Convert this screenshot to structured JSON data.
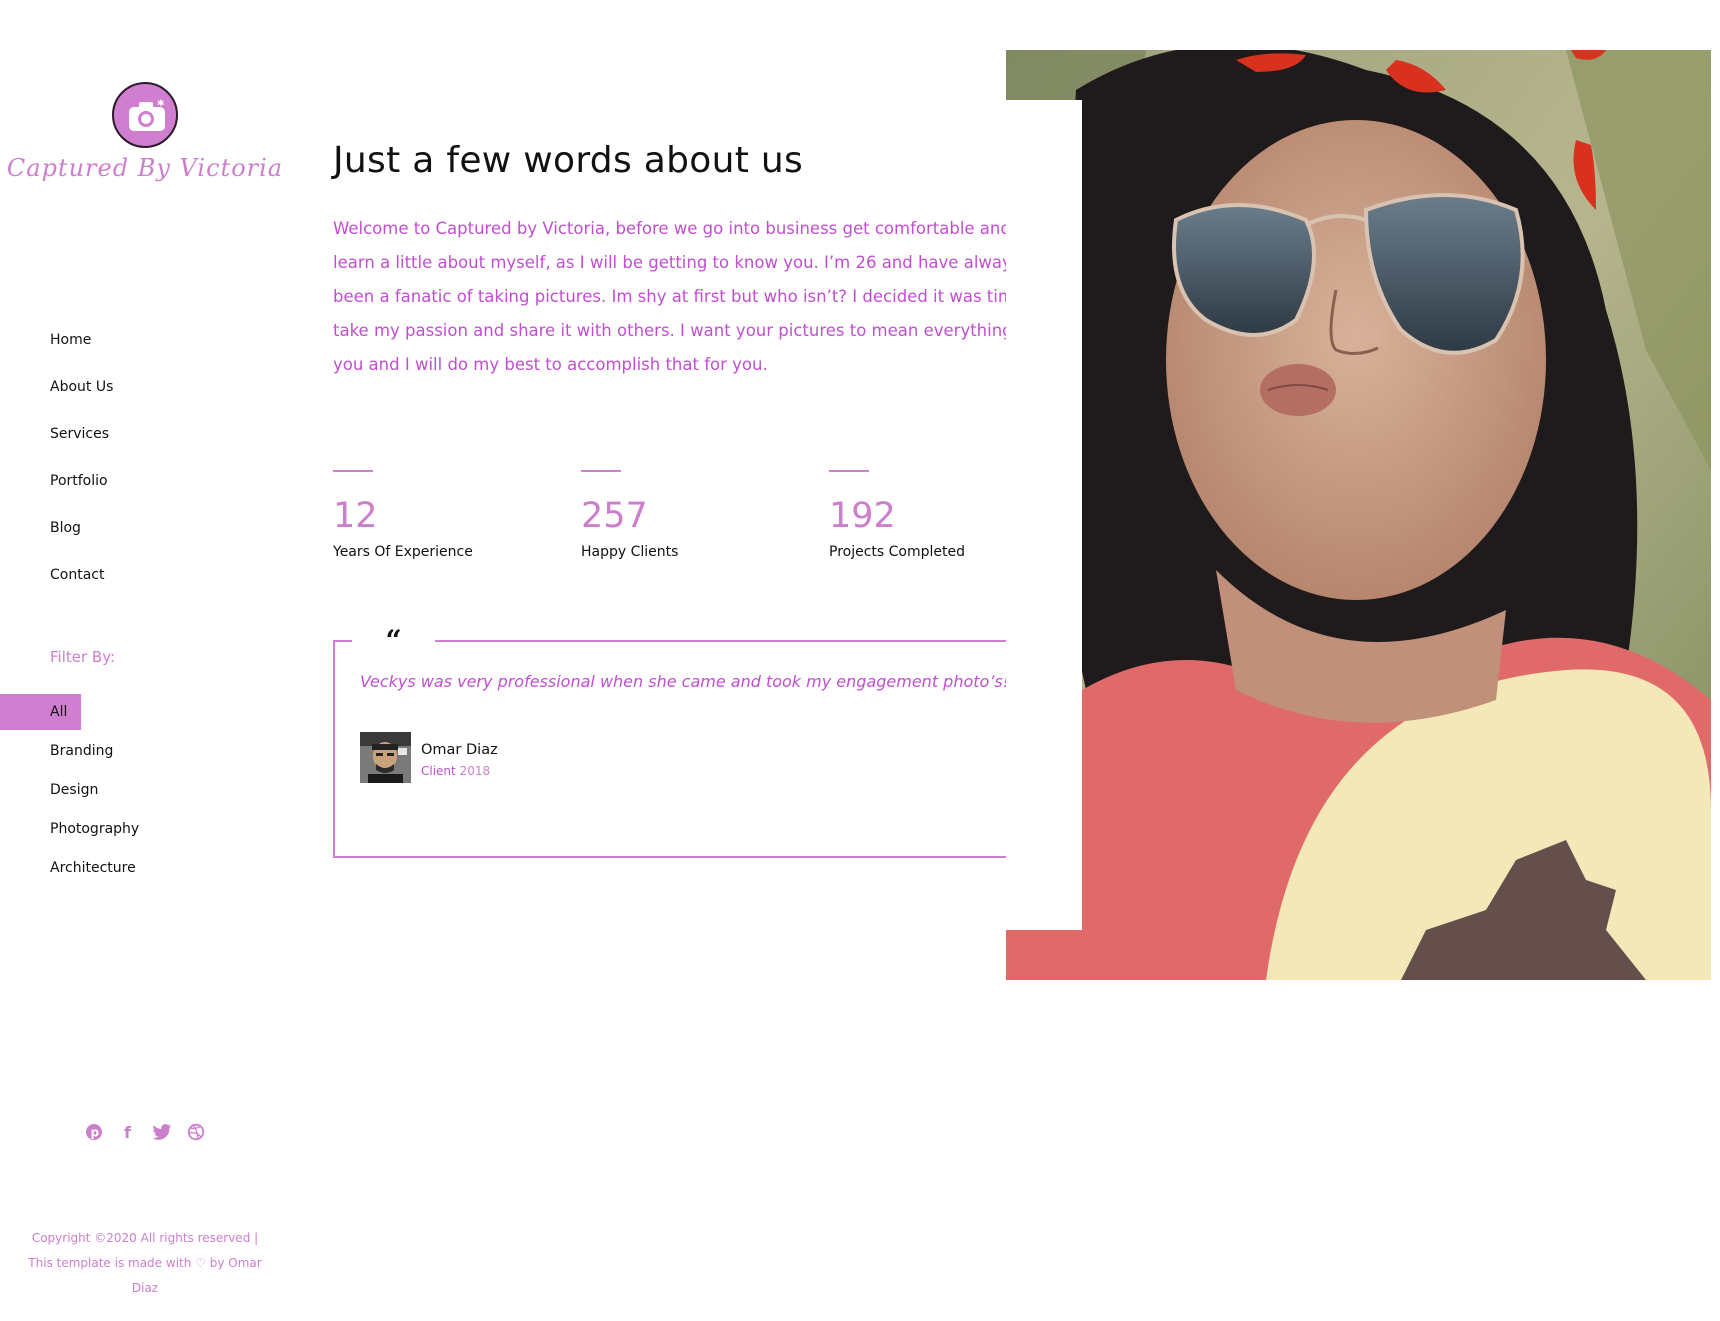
{
  "brand": {
    "logo_text": "Captured By  Victoria",
    "logo_icon": "camera-icon"
  },
  "nav": {
    "items": [
      {
        "label": "Home"
      },
      {
        "label": "About Us"
      },
      {
        "label": "Services"
      },
      {
        "label": "Portfolio"
      },
      {
        "label": "Blog"
      },
      {
        "label": "Contact"
      }
    ]
  },
  "filter": {
    "title": "Filter By:",
    "items": [
      {
        "label": "All",
        "active": true
      },
      {
        "label": "Branding"
      },
      {
        "label": "Design"
      },
      {
        "label": "Photography"
      },
      {
        "label": "Architecture"
      }
    ]
  },
  "socials": [
    {
      "icon": "pinterest-icon",
      "glyph": "℗"
    },
    {
      "icon": "facebook-icon",
      "glyph": "f"
    },
    {
      "icon": "twitter-icon",
      "glyph": "🐦"
    },
    {
      "icon": "dribbble-icon",
      "glyph": "◎"
    }
  ],
  "footer": {
    "line1": "Copyright ©2020 All rights reserved |",
    "line2": "This template is made with ♡ by Omar",
    "line3": "Diaz"
  },
  "about": {
    "heading": "Just a few words about us",
    "intro": "Welcome to Captured by Victoria, before we go into business get comfortable and learn a little about myself, as I will be getting to know you. I’m 26 and have always been a fanatic of taking pictures. Im shy at first but who isn’t? I decided it was time to take my passion and share it with others. I want your pictures to mean everything to you and I will do my best to accomplish that for you."
  },
  "stats": [
    {
      "value": "12",
      "label": "Years Of Experience"
    },
    {
      "value": "257",
      "label": "Happy Clients"
    },
    {
      "value": "192",
      "label": "Projects Completed"
    }
  ],
  "testimonial": {
    "quote_mark": "“",
    "text": "Veckys was very professional when she came and took my engagement photo’s!",
    "author": "Omar Diaz",
    "role": "Client",
    "year": "2018",
    "slides": 2,
    "active_slide": 1
  },
  "colors": {
    "accent": "#d07ed0",
    "accent_text": "#c04fd0"
  }
}
